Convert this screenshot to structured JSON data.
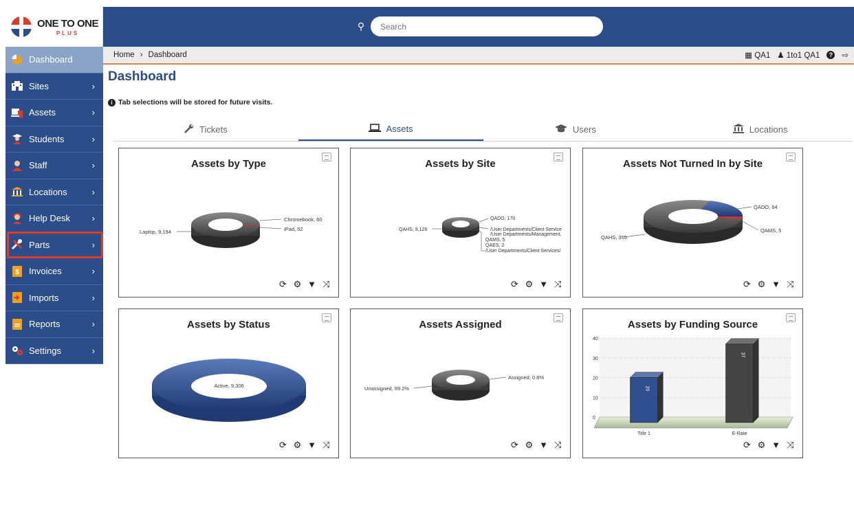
{
  "brand": {
    "name": "ONE TO ONE",
    "sub": "PLUS"
  },
  "search": {
    "placeholder": "Search"
  },
  "sidebar": {
    "items": [
      {
        "label": "Dashboard",
        "icon": "pie-icon"
      },
      {
        "label": "Sites",
        "icon": "building-icon"
      },
      {
        "label": "Assets",
        "icon": "laptop-icon"
      },
      {
        "label": "Students",
        "icon": "student-icon"
      },
      {
        "label": "Staff",
        "icon": "person-icon"
      },
      {
        "label": "Locations",
        "icon": "institution-icon"
      },
      {
        "label": "Help Desk",
        "icon": "support-icon"
      },
      {
        "label": "Parts",
        "icon": "tools-icon"
      },
      {
        "label": "Invoices",
        "icon": "invoice-icon"
      },
      {
        "label": "Imports",
        "icon": "import-icon"
      },
      {
        "label": "Reports",
        "icon": "report-icon"
      },
      {
        "label": "Settings",
        "icon": "gears-icon"
      }
    ]
  },
  "breadcrumb": {
    "home": "Home",
    "current": "Dashboard"
  },
  "user": {
    "site": "QA1",
    "name": "1to1 QA1"
  },
  "page": {
    "title": "Dashboard",
    "note": "Tab selections will be stored for future visits."
  },
  "tabs": [
    {
      "label": "Tickets",
      "icon": "wrench-icon"
    },
    {
      "label": "Assets",
      "icon": "laptop-icon"
    },
    {
      "label": "Users",
      "icon": "graduation-cap-icon"
    },
    {
      "label": "Locations",
      "icon": "institution-icon"
    }
  ],
  "cards": [
    {
      "title": "Assets by Type"
    },
    {
      "title": "Assets by Site"
    },
    {
      "title": "Assets Not Turned In by Site"
    },
    {
      "title": "Assets by Status"
    },
    {
      "title": "Assets Assigned"
    },
    {
      "title": "Assets by Funding Source"
    }
  ],
  "chart_data": [
    {
      "type": "pie",
      "title": "Assets by Type",
      "labels": [
        "Laptop, 9,194",
        "Chromebook, 60",
        "iPad, 52"
      ],
      "values": [
        9194,
        60,
        52
      ]
    },
    {
      "type": "pie",
      "title": "Assets by Site",
      "labels": [
        "QAHS, 9,126",
        "QADO, 170",
        "/User Departments/Client Service",
        "/User Departments/Management,",
        "QAMS, 5",
        "QAES, 2",
        "/User Departments/Client Services/"
      ],
      "values": [
        9126,
        170,
        null,
        null,
        5,
        2,
        null
      ]
    },
    {
      "type": "pie",
      "title": "Assets Not Turned In by Site",
      "labels": [
        "QAHS, 355",
        "QADO, 64",
        "QAMS, 5"
      ],
      "values": [
        355,
        64,
        5
      ]
    },
    {
      "type": "pie",
      "title": "Assets by Status",
      "labels": [
        "Active, 9,306"
      ],
      "values": [
        9306
      ]
    },
    {
      "type": "pie",
      "title": "Assets Assigned",
      "labels": [
        "Unassigned, 99.2%",
        "Assigned, 0.8%"
      ],
      "values": [
        99.2,
        0.8
      ]
    },
    {
      "type": "bar",
      "title": "Assets by Funding Source",
      "categories": [
        "Title 1",
        "E-Rate"
      ],
      "values": [
        20,
        37
      ],
      "yticks": [
        "40",
        "30",
        "20",
        "10",
        "0"
      ],
      "ylim": [
        0,
        40
      ],
      "colors": [
        "#2f4f8f",
        "#444444"
      ]
    }
  ],
  "colors": {
    "brand": "#2b4d8a",
    "accent": "#e03a2b",
    "highlight": "#e0814c"
  }
}
